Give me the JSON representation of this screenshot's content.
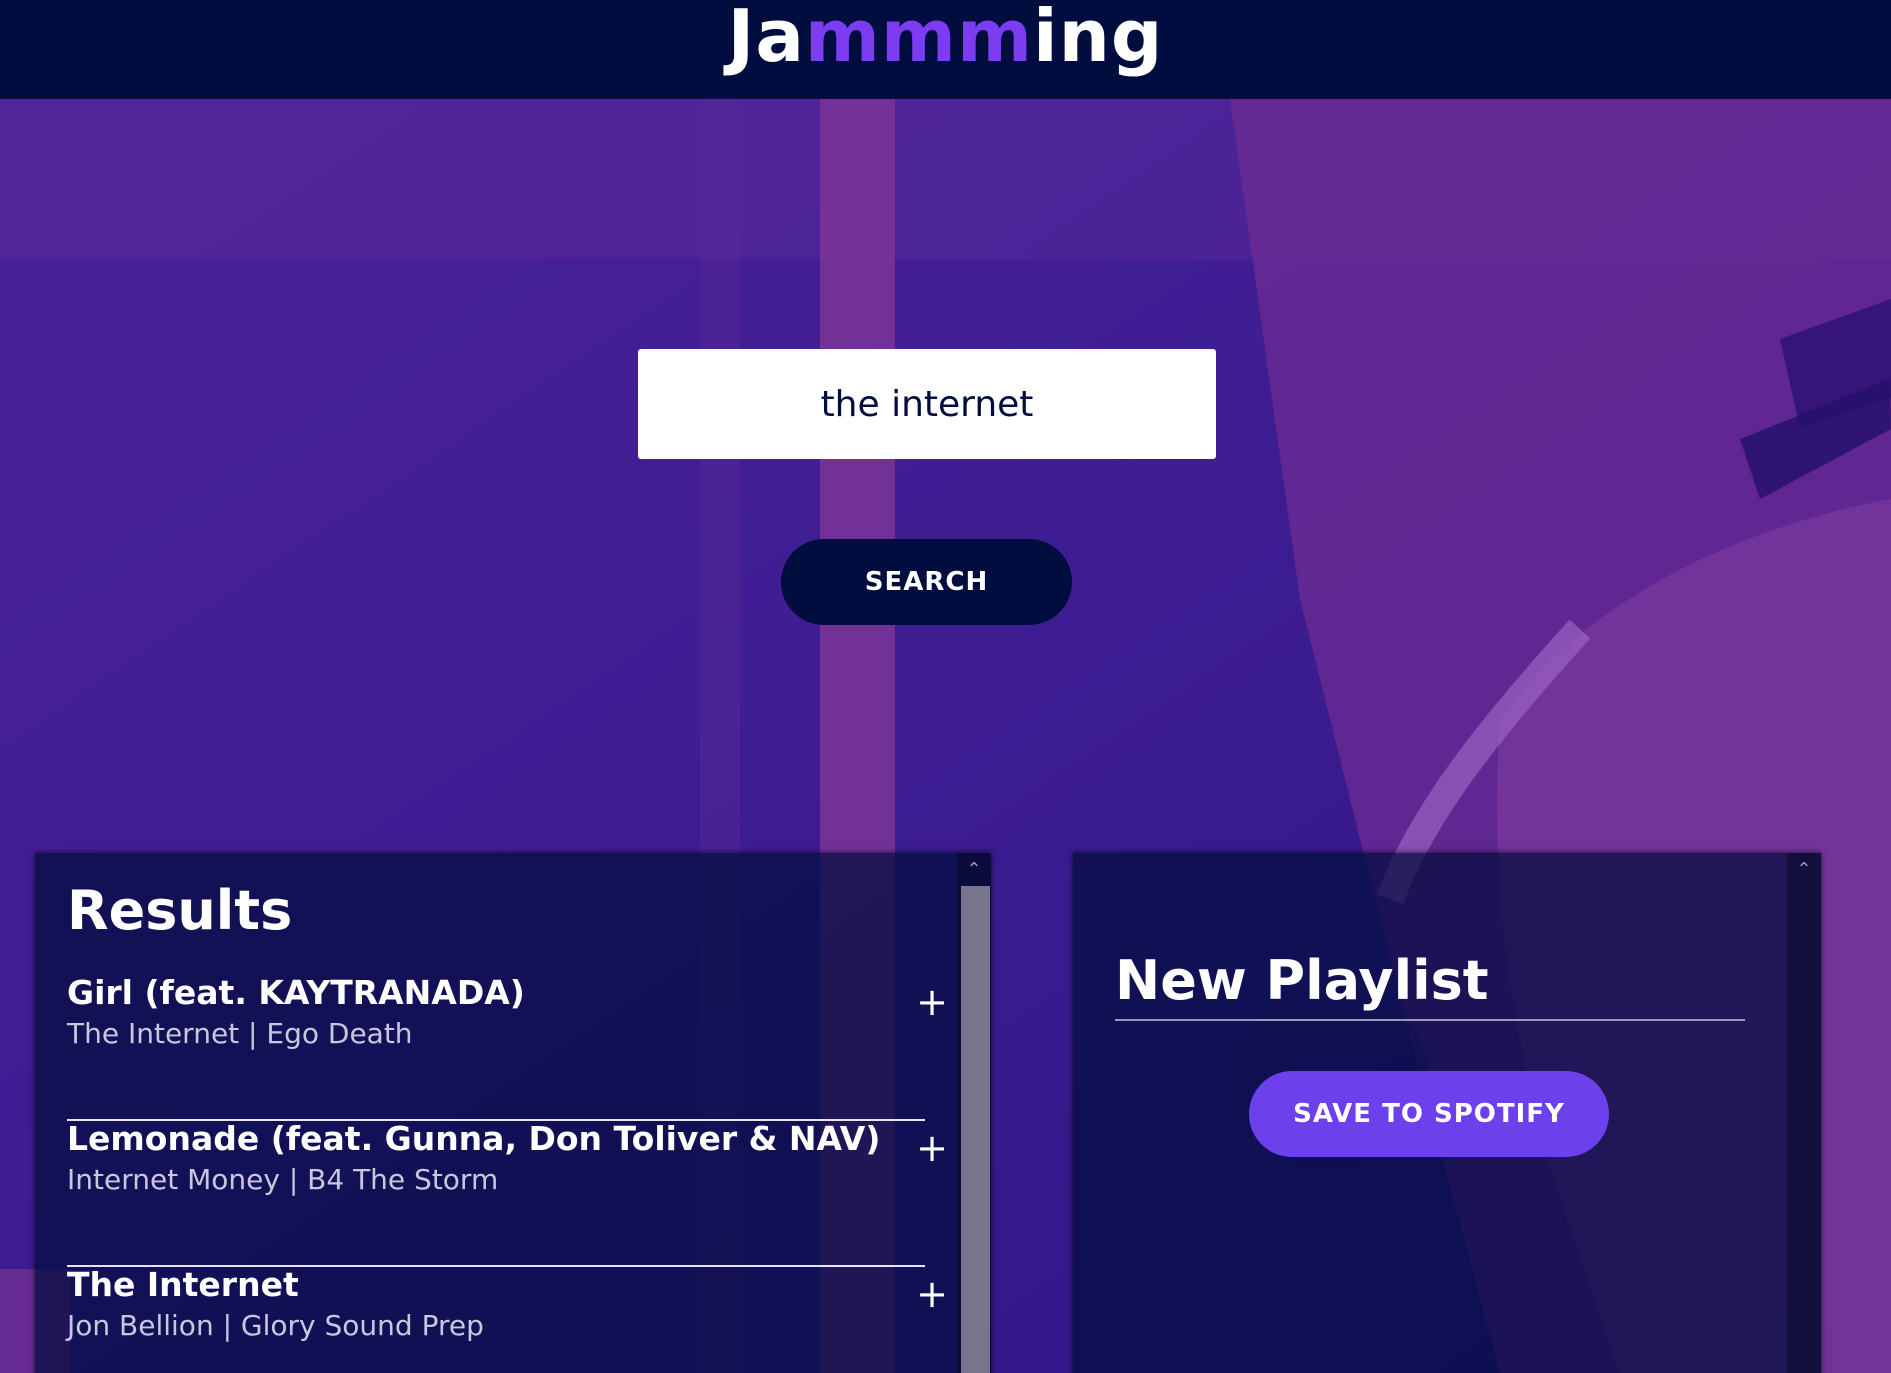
{
  "header": {
    "logo_prefix": "Ja",
    "logo_accent": "mmm",
    "logo_suffix": "ing"
  },
  "search": {
    "value": "the internet",
    "button_label": "SEARCH"
  },
  "results": {
    "title": "Results",
    "tracks": [
      {
        "name": "Girl (feat. KAYTRANADA)",
        "info": "The Internet | Ego Death",
        "action": "+"
      },
      {
        "name": "Lemonade (feat. Gunna, Don Toliver & NAV)",
        "info": "Internet Money | B4 The Storm",
        "action": "+"
      },
      {
        "name": "The Internet",
        "info": "Jon Bellion | Glory Sound Prep",
        "action": "+"
      }
    ]
  },
  "playlist": {
    "name": "New Playlist",
    "save_label": "SAVE TO SPOTIFY"
  },
  "scroll_arrow": "⌃",
  "colors": {
    "header_bg": "#010c3f",
    "accent": "#7b3cf2",
    "save_button": "#6c41ec",
    "panel_bg": "#010c3f"
  }
}
